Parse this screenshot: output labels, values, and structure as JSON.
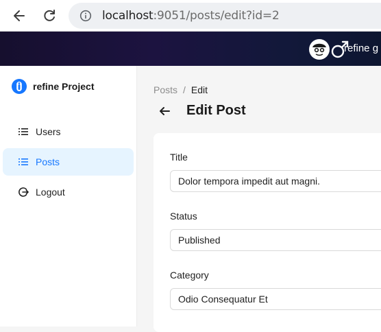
{
  "browser": {
    "url_host": "localhost",
    "url_rest": ":9051/posts/edit?id=2"
  },
  "header": {
    "text": "refine g"
  },
  "sidebar": {
    "brand": "refine Project",
    "items": [
      {
        "label": "Users",
        "icon": "list-icon",
        "active": false
      },
      {
        "label": "Posts",
        "icon": "list-icon",
        "active": true
      },
      {
        "label": "Logout",
        "icon": "logout-icon",
        "active": false
      }
    ]
  },
  "breadcrumb": {
    "parent": "Posts",
    "separator": "/",
    "current": "Edit"
  },
  "page": {
    "title": "Edit Post"
  },
  "form": {
    "title_label": "Title",
    "title_value": "Dolor tempora impedit aut magni.",
    "status_label": "Status",
    "status_value": "Published",
    "category_label": "Category",
    "category_value": "Odio Consequatur Et"
  },
  "colors": {
    "accent": "#1677ff",
    "active_bg": "#e6f4ff",
    "header_bg": "#1c1340"
  }
}
